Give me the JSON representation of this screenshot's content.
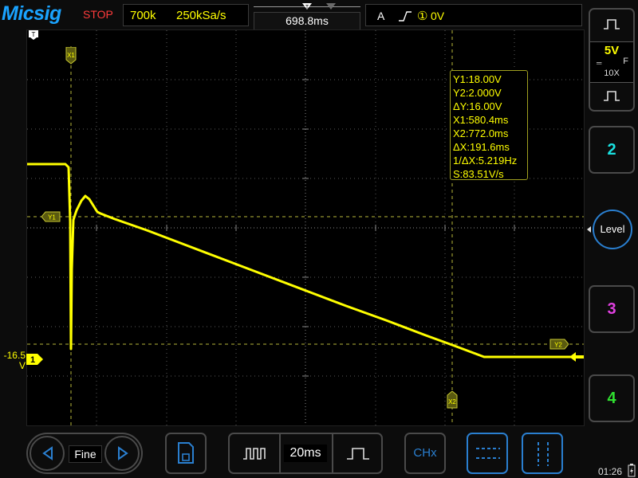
{
  "header": {
    "brand": "Micsig",
    "run_state": "STOP",
    "memory_depth": "700k",
    "sample_rate": "250kSa/s",
    "time_offset": "698.8ms",
    "trigger_mode": "A",
    "trigger_source_icon": "rising-edge-icon",
    "trigger_source_channel": "①",
    "trigger_level": "0V"
  },
  "screen": {
    "ch1_offset_label": "-16.5 V",
    "ch1_marker": "1",
    "cursor_labels": {
      "x1": "X1",
      "x2": "X2",
      "y1": "Y1",
      "y2": "Y2"
    },
    "measurements": [
      "Y1:18.00V",
      "Y2:2.000V",
      "ΔY:16.00V",
      "X1:580.4ms",
      "X2:772.0ms",
      "ΔX:191.6ms",
      "1/ΔX:5.219Hz",
      "S:83.51V/s"
    ]
  },
  "right_panel": {
    "ch1_scale": "5V",
    "ch1_coupling": "F",
    "ch1_probe": "10X",
    "ch2_label": "2",
    "level_label": "Level",
    "ch3_label": "3",
    "ch4_label": "4",
    "colors": {
      "ch1": "#ffff00",
      "ch2": "#19e0e0",
      "ch3": "#e040e0",
      "ch4": "#30e030"
    }
  },
  "bottom": {
    "fine_label": "Fine",
    "timebase": "20ms",
    "chx_label": "CHx",
    "time": "01:26"
  }
}
